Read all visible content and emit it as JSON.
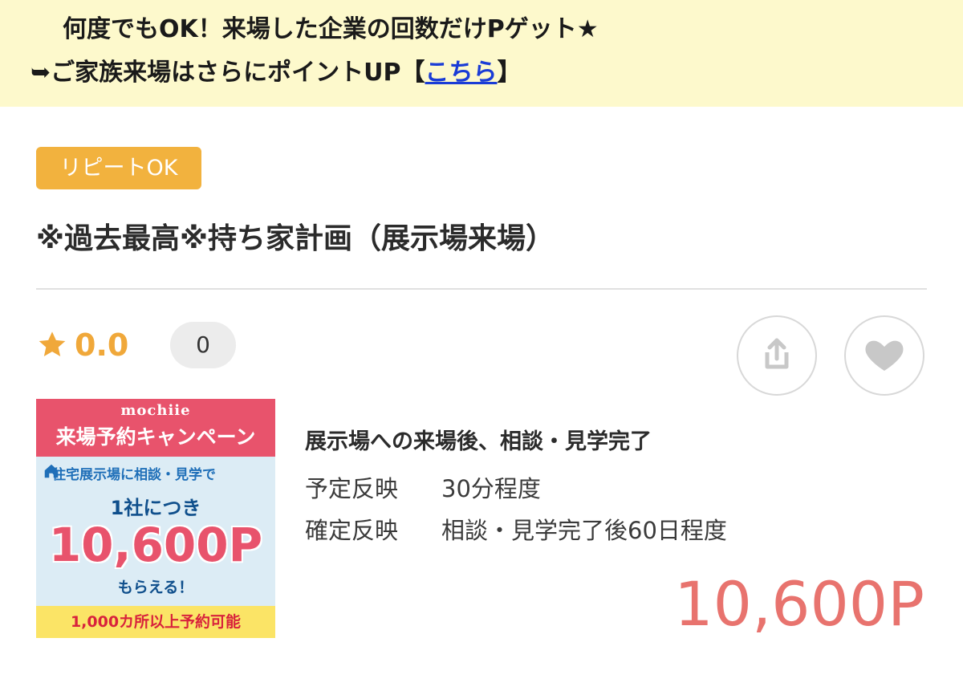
{
  "notice": {
    "line1": "何度でもOK！来場した企業の回数だけPゲット★",
    "line2_prefix": "➥ご家族来場はさらにポイントUP【",
    "line2_link": "こちら",
    "line2_suffix": "】"
  },
  "badge": "リピートOK",
  "title": "※過去最高※持ち家計画（展示場来場）",
  "rating": {
    "value": "0.0",
    "count": "0"
  },
  "banner": {
    "brand": "mochiie",
    "campaign": "来場予約キャンペーン",
    "subtitle": "住宅展示場に相談・見学で",
    "per_company": "1社につき",
    "points": "10,600P",
    "get": "もらえる！",
    "bottom": "1,000カ所以上予約可能"
  },
  "details": {
    "heading": "展示場への来場後、相談・見学完了",
    "rows": [
      {
        "label": "予定反映",
        "value": "30分程度"
      },
      {
        "label": "確定反映",
        "value": "相談・見学完了後60日程度"
      }
    ]
  },
  "points": "10,600P",
  "colors": {
    "notice_bg": "#fdf9cc",
    "badge": "#f2b23e",
    "star": "#f0a83a",
    "points": "#e8736e",
    "link": "#1a3cd6"
  },
  "icons": {
    "rating": "star-icon",
    "share": "share-icon",
    "favorite": "heart-icon"
  }
}
